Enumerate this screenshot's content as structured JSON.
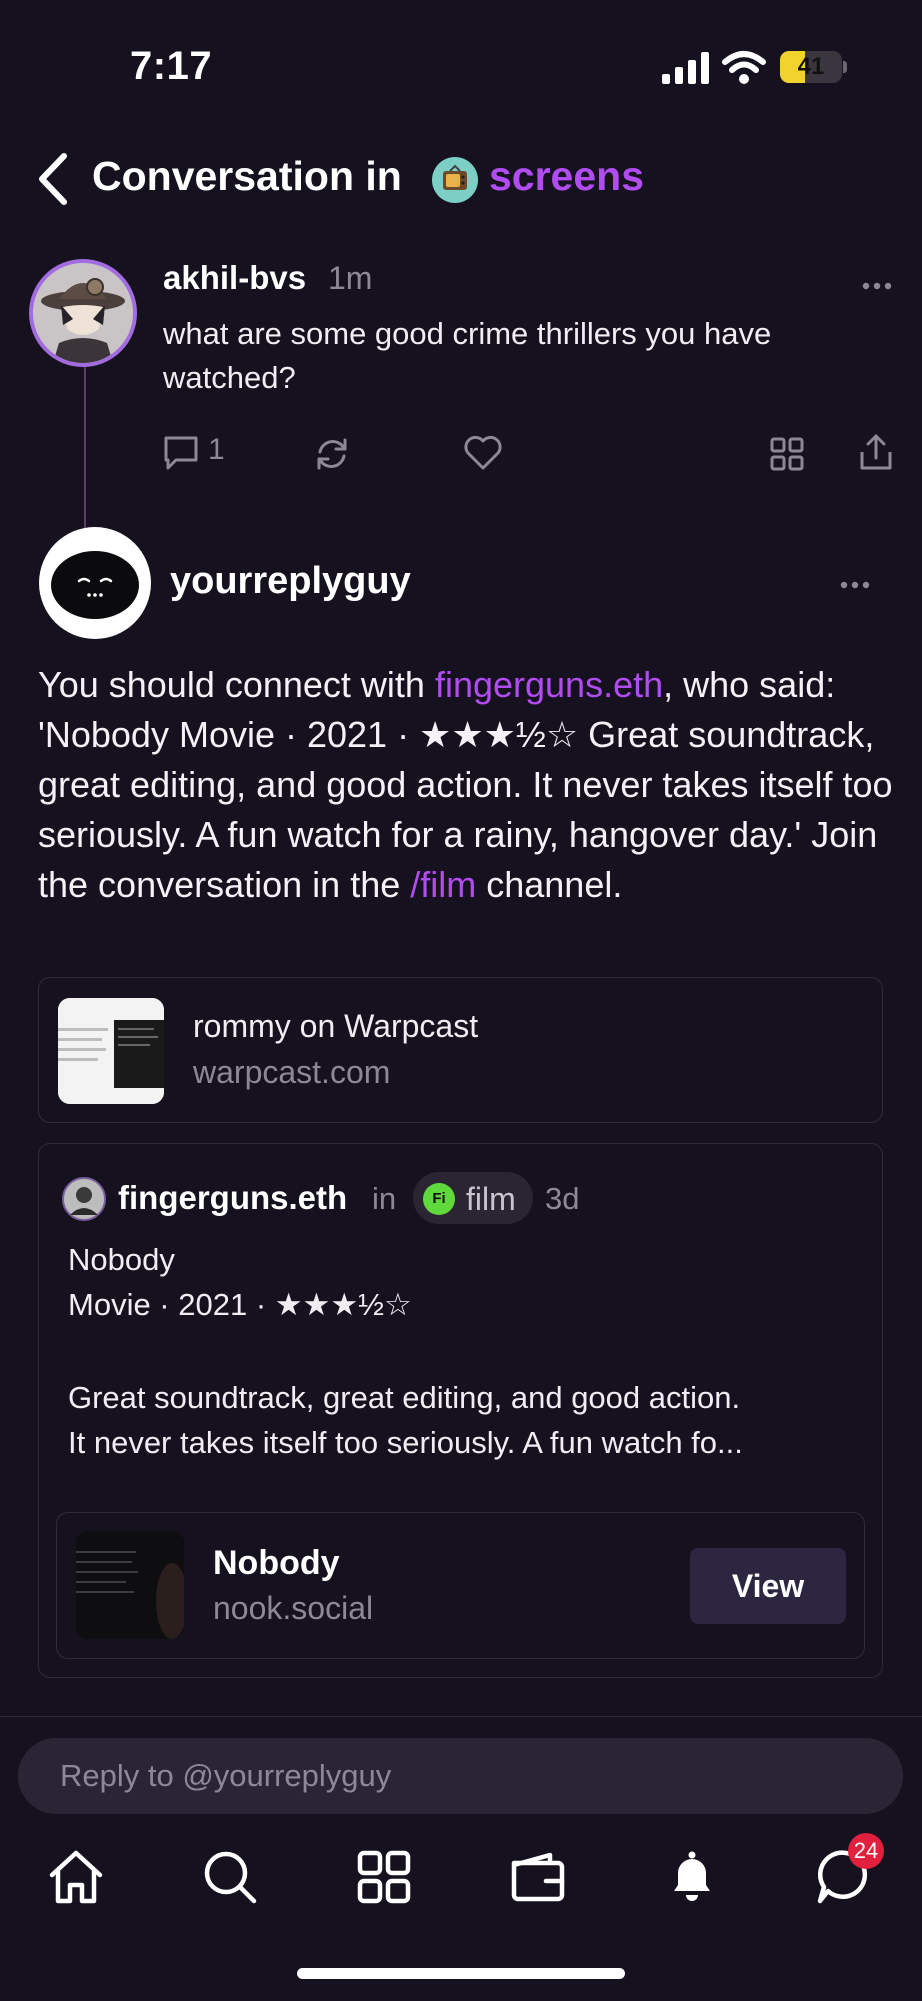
{
  "status_bar": {
    "time": "7:17",
    "battery": "41",
    "battery_level": 0.41
  },
  "header": {
    "title": "Conversation in",
    "channel": "screens"
  },
  "parent_cast": {
    "author": "akhil-bvs",
    "time": "1m",
    "text": "what are some good crime thrillers you have watched?",
    "reply_count": "1"
  },
  "reply_cast": {
    "author": "yourreplyguy",
    "text_part1": "You should connect with ",
    "mention": "fingerguns.eth",
    "text_part2": ", who said: 'Nobody Movie · 2021 · ★★★½☆ Great soundtrack, great editing, and good action. It never takes itself too seriously. A fun watch for a rainy, hangover day.' Join the conversation in the ",
    "channel_link": "/film",
    "text_part3": " channel."
  },
  "link_card": {
    "title": "rommy on Warpcast",
    "domain": "warpcast.com"
  },
  "quoted_cast": {
    "author": "fingerguns.eth",
    "in_word": "in",
    "channel_icon": "Fi",
    "channel": "film",
    "time": "3d",
    "line1": "Nobody",
    "line2": "Movie · 2021 · ★★★½☆",
    "line3": "Great soundtrack, great editing, and good action.",
    "line4": "It never takes itself too seriously. A fun watch fo...",
    "embed": {
      "title": "Nobody",
      "domain": "nook.social",
      "button": "View"
    }
  },
  "reply_input": {
    "placeholder": "Reply to @yourreplyguy"
  },
  "tab_bar": {
    "items": [
      "home-icon",
      "search-icon",
      "apps-grid-icon",
      "wallet-icon",
      "bell-icon",
      "chat-icon"
    ],
    "chat_badge": "24"
  },
  "colors": {
    "background": "#16111f",
    "accent": "#b04cf0",
    "badge": "#e0203c"
  }
}
